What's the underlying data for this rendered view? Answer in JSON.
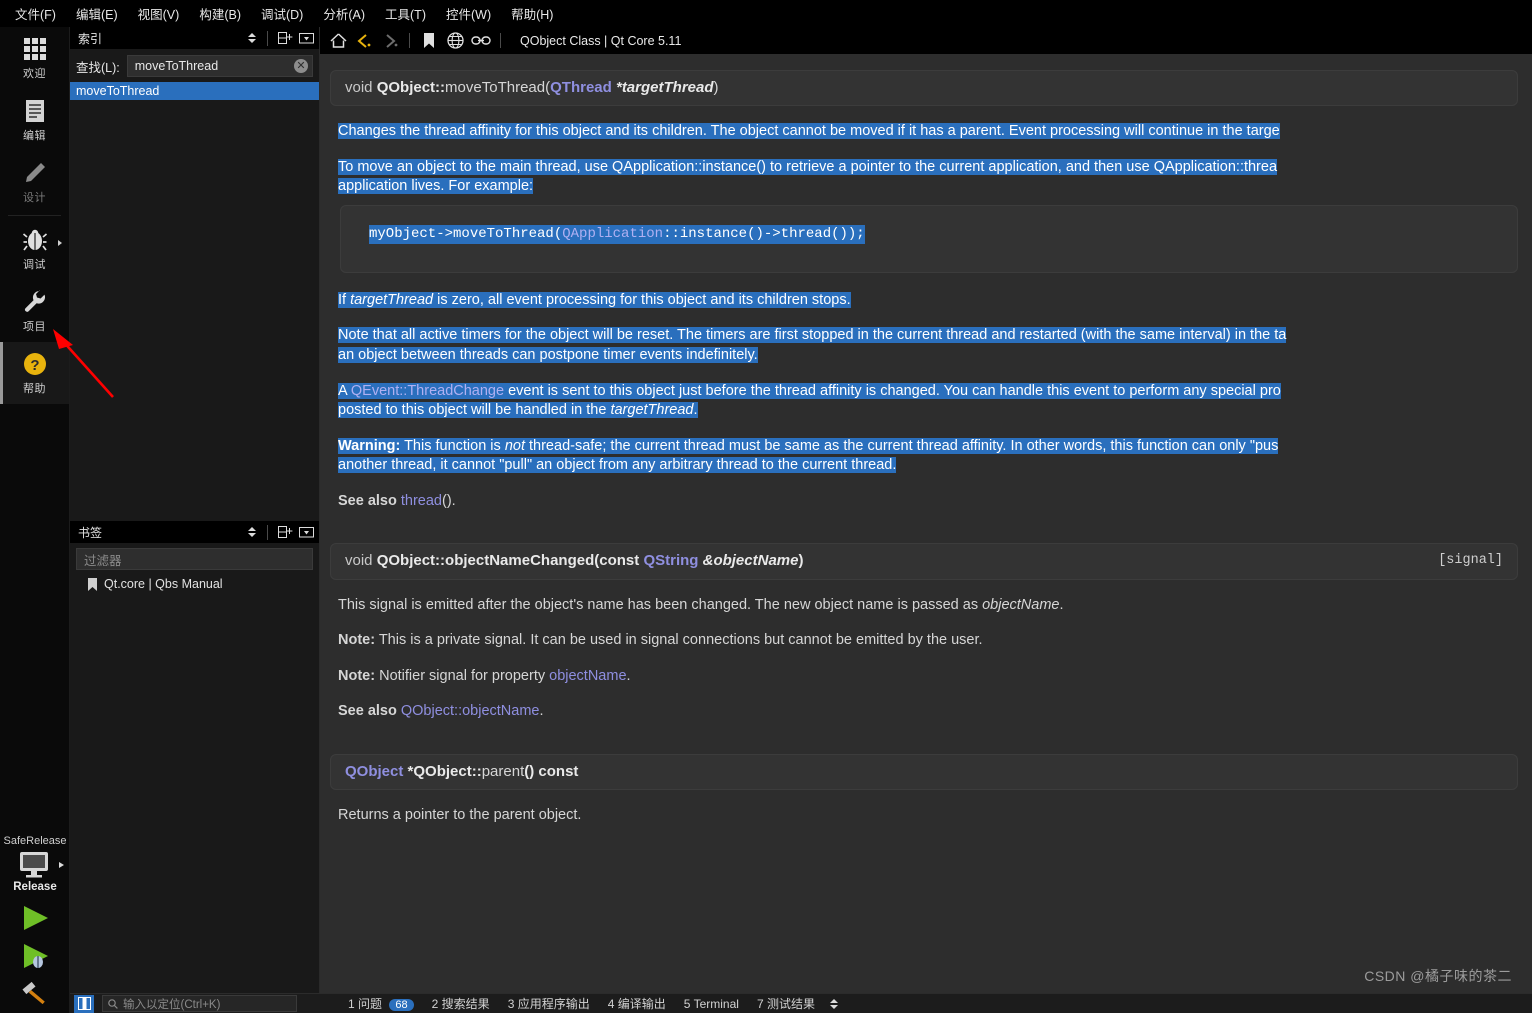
{
  "menubar": {
    "items": [
      {
        "label": "文件(F)",
        "mnemonic": "F"
      },
      {
        "label": "编辑(E)",
        "mnemonic": "E"
      },
      {
        "label": "视图(V)",
        "mnemonic": "V"
      },
      {
        "label": "构建(B)",
        "mnemonic": "B"
      },
      {
        "label": "调试(D)",
        "mnemonic": "D"
      },
      {
        "label": "分析(A)",
        "mnemonic": "A"
      },
      {
        "label": "工具(T)",
        "mnemonic": "T"
      },
      {
        "label": "控件(W)",
        "mnemonic": "W"
      },
      {
        "label": "帮助(H)",
        "mnemonic": "H"
      }
    ]
  },
  "rail": {
    "modes": [
      {
        "label": "欢迎",
        "icon": "grid-icon",
        "state": "normal"
      },
      {
        "label": "编辑",
        "icon": "document-icon",
        "state": "normal"
      },
      {
        "label": "设计",
        "icon": "pencil-icon",
        "state": "disabled"
      },
      {
        "label": "调试",
        "icon": "bug-icon",
        "state": "normal"
      },
      {
        "label": "项目",
        "icon": "wrench-icon",
        "state": "normal"
      },
      {
        "label": "帮助",
        "icon": "question-circle-icon",
        "state": "selected"
      }
    ],
    "kit_label": "SafeRelease",
    "build_config": "Release",
    "run_button": "run-icon",
    "debug_button": "debug-icon",
    "build_button": "build-hammer-icon"
  },
  "index_dock": {
    "title": "索引",
    "find_label": "查找(L):",
    "find_value": "moveToThread",
    "clear_icon": "clear-icon",
    "add_icon": "add-split-icon",
    "menu_icon": "dock-menu-icon",
    "results": [
      {
        "label": "moveToThread",
        "selected": true
      }
    ]
  },
  "bookmarks_dock": {
    "title": "书签",
    "filter_placeholder": "过滤器",
    "add_icon": "add-split-icon",
    "menu_icon": "dock-menu-icon",
    "items": [
      {
        "label": "Qt.core | Qbs Manual",
        "icon": "bookmark-icon"
      }
    ]
  },
  "viewer_toolbar": {
    "home": "home-icon",
    "back": "back-arrow-icon",
    "forward": "forward-arrow-icon",
    "bookmark": "bookmark-icon",
    "globe": "globe-icon",
    "link": "link-icon",
    "page_title": "QObject Class | Qt Core 5.11"
  },
  "doc": {
    "sig1": {
      "ret": "void",
      "cls": "QObject::",
      "fn": "moveToThread",
      "open": "(",
      "argtype": "QThread",
      "argptr": " *",
      "argname": "targetThread",
      "close": ")"
    },
    "p1": "Changes the thread affinity for this object and its children. The object cannot be moved if it has a parent. Event processing will continue in the targe",
    "p2a": "To move an object to the main thread, use QApplication::instance() to retrieve a pointer to the current application, and then use QApplication::threa",
    "p2b": "application lives. For example:",
    "code": {
      "pre": "myObject->moveToThread(",
      "link": "QApplication",
      "post": "::instance()->thread());"
    },
    "p3_a": "If ",
    "p3_i": "targetThread",
    "p3_b": " is zero, all event processing for this object and its children stops.",
    "p4a": "Note that all active timers for the object will be reset. The timers are first stopped in the current thread and restarted (with the same interval) in the ta",
    "p4b": "an object between threads can postpone timer events indefinitely.",
    "p5_a": "A ",
    "p5_link": "QEvent::ThreadChange",
    "p5_b": " event is sent to this object just before the thread affinity is changed. You can handle this event to perform any special pro",
    "p5c_a": "posted to this object will be handled in the ",
    "p5c_i": "targetThread",
    "p5c_b": ".",
    "warn_label": "Warning:",
    "warn_a": " This function is ",
    "warn_i": "not",
    "warn_b": " thread-safe; the current thread must be same as the current thread affinity. In other words, this function can only \"pus",
    "warn_c": "another thread, it cannot \"pull\" an object from any arbitrary thread to the current thread.",
    "seealso1_label": "See also ",
    "seealso1_link": "thread",
    "seealso1_tail": "().",
    "sig2": {
      "ret": "void",
      "cls": "QObject::",
      "fn": "objectNameChanged",
      "open": "(",
      "const": "const ",
      "argtype": "QString",
      "argamp": " &",
      "argname": "objectName",
      "close": ")",
      "tag": "[signal]"
    },
    "p6_a": "This signal is emitted after the object's name has been changed. The new object name is passed as ",
    "p6_i": "objectName",
    "p6_b": ".",
    "note1_label": "Note:",
    "note1_text": " This is a private signal. It can be used in signal connections but cannot be emitted by the user.",
    "note2_label": "Note:",
    "note2_text": " Notifier signal for property ",
    "note2_link": "objectName",
    "note2_tail": ".",
    "seealso2_label": "See also ",
    "seealso2_link": "QObject::objectName",
    "seealso2_tail": ".",
    "sig3": {
      "type": "QObject",
      "ptr": " *",
      "cls": "QObject::",
      "fn": "parent",
      "tail": "() const"
    },
    "p7": "Returns a pointer to the parent object."
  },
  "statusbar": {
    "toggle_icon": "sidebar-toggle-icon",
    "locator_icon": "search-icon",
    "locator_placeholder": "输入以定位(Ctrl+K)",
    "panes": [
      {
        "num": "1",
        "label": "问题",
        "badge": "68"
      },
      {
        "num": "2",
        "label": "搜索结果",
        "badge": ""
      },
      {
        "num": "3",
        "label": "应用程序输出",
        "badge": ""
      },
      {
        "num": "4",
        "label": "编译输出",
        "badge": ""
      },
      {
        "num": "5",
        "label": "Terminal",
        "badge": ""
      },
      {
        "num": "7",
        "label": "测试结果",
        "badge": ""
      }
    ]
  },
  "watermark": "CSDN @橘子味的茶二",
  "colors": {
    "selection": "#2a6fbd",
    "link": "#8f8fe0",
    "accent_yellow": "#e8b30d",
    "annotation_arrow": "#ff0000"
  }
}
